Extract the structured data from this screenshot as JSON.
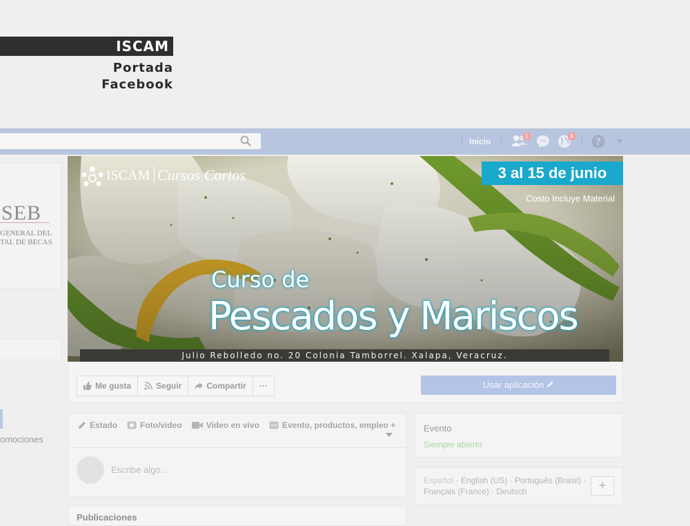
{
  "header": {
    "brand": "ISCAM",
    "line1": "Portada",
    "line2": "Facebook"
  },
  "topbar": {
    "home_label": "Inicio",
    "friend_requests_badge": "1",
    "notifications_badge": "8",
    "icons": [
      "search-icon",
      "friends-icon",
      "messenger-icon",
      "globe-icon",
      "help-icon",
      "caret-down-icon"
    ]
  },
  "left_column": {
    "seb_title": "SEB",
    "seb_line1": "GENERAL DEL",
    "seb_line2": "TAL DE BECAS",
    "promo_text": "omociones"
  },
  "cover": {
    "logo_text": "ISCAM",
    "logo_script": "Cursos Cortos",
    "date_banner": "3 al 15 de junio",
    "cost_note": "Costo Incluye Material",
    "title_small": "Curso de",
    "title_big": "Pescados y Mariscos",
    "address": "Julio Rebolledo no. 20 Colonia Tamborrel. Xalapa, Veracruz."
  },
  "actions": {
    "like": "Me gusta",
    "follow": "Seguir",
    "share": "Compartir",
    "more": "···",
    "use_app": "Usar aplicación"
  },
  "composer": {
    "tabs": [
      "Estado",
      "Foto/video",
      "Video en vivo",
      "Evento, productos, empleo +"
    ],
    "placeholder": "Escribe algo..."
  },
  "publications_label": "Publicaciones",
  "event_card": {
    "label": "Evento",
    "status": "Siempre abierto"
  },
  "languages": {
    "current": "Español",
    "others": [
      "English (US)",
      "Português (Brasil)",
      "Français (France)",
      "Deutsch"
    ],
    "add": "+"
  },
  "colors": {
    "topbar": "#b8c5de",
    "date_banner": "#1aa8cc",
    "use_app_button": "#b3c4e6"
  }
}
